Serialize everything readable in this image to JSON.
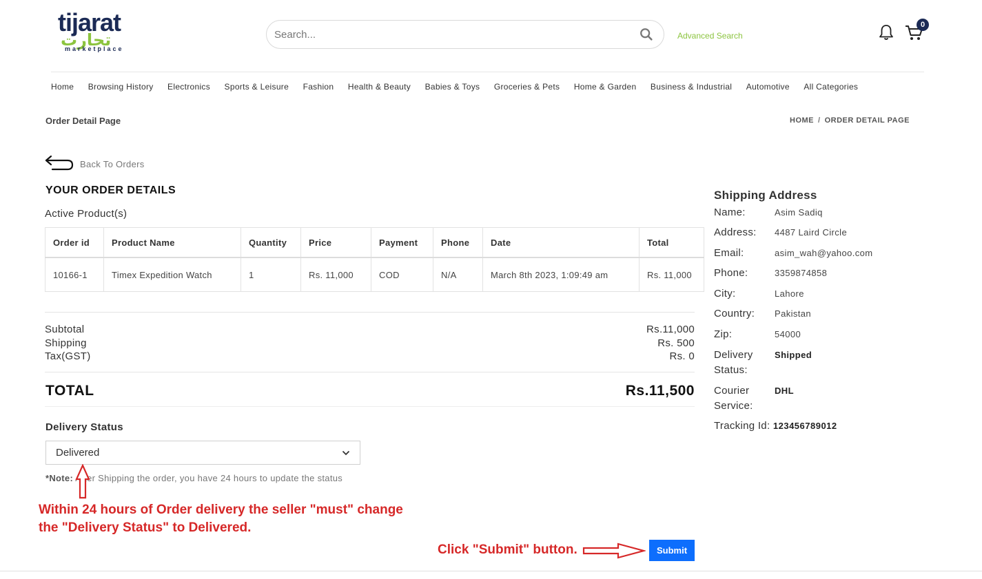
{
  "header": {
    "logo": {
      "main": "tijarat",
      "arabic": "تجارت",
      "sub": "marketplace"
    },
    "search": {
      "placeholder": "Search..."
    },
    "advanced_search": "Advanced Search",
    "cart_count": "0"
  },
  "nav": {
    "items": [
      "Home",
      "Browsing History",
      "Electronics",
      "Sports & Leisure",
      "Fashion",
      "Health & Beauty",
      "Babies & Toys",
      "Groceries & Pets",
      "Home & Garden",
      "Business & Industrial",
      "Automotive",
      "All Categories"
    ]
  },
  "page": {
    "title": "Order Detail Page",
    "breadcrumb": {
      "home": "HOME",
      "sep": "/",
      "current": "ORDER DETAIL PAGE"
    },
    "back": "Back To Orders",
    "order_title": "YOUR ORDER DETAILS",
    "active_products": "Active Product(s)"
  },
  "table": {
    "headers": [
      "Order id",
      "Product Name",
      "Quantity",
      "Price",
      "Payment",
      "Phone",
      "Date",
      "Total"
    ],
    "rows": [
      [
        "10166-1",
        "Timex Expedition Watch",
        "1",
        "Rs. 11,000",
        "COD",
        "N/A",
        "March 8th 2023, 1:09:49 am",
        "Rs. 11,000"
      ]
    ]
  },
  "summary": {
    "subtotal_label": "Subtotal",
    "subtotal_value": "Rs.11,000",
    "shipping_label": "Shipping",
    "shipping_value": "Rs. 500",
    "tax_label": "Tax(GST)",
    "tax_value": "Rs. 0",
    "total_label": "TOTAL",
    "total_value": "Rs.11,500"
  },
  "delivery": {
    "label": "Delivery Status",
    "selected": "Delivered",
    "note_bold": "*Note:",
    "note_text": " After Shipping the order, you have 24 hours to update the status",
    "submit": "Submit"
  },
  "annotations": {
    "text1_line1": "Within 24 hours of Order delivery the seller \"must\" change",
    "text1_line2": "the \"Delivery Status\" to Delivered.",
    "text2": "Click \"Submit\" button.",
    "color": "#d62828"
  },
  "shipping": {
    "title": "Shipping Address",
    "name_label": "Name:",
    "name": "Asim Sadiq",
    "address_label": "Address:",
    "address": "4487 Laird Circle",
    "email_label": "Email:",
    "email": "asim_wah@yahoo.com",
    "phone_label": "Phone:",
    "phone": "3359874858",
    "city_label": "City:",
    "city": "Lahore",
    "country_label": "Country:",
    "country": "Pakistan",
    "zip_label": "Zip:",
    "zip": "54000",
    "delivery_status_label": "Delivery Status:",
    "delivery_status": "Shipped",
    "courier_label": "Courier Service:",
    "courier": "DHL",
    "tracking_label": "Tracking Id:",
    "tracking": "123456789012"
  },
  "colors": {
    "brand_navy": "#1b2a55",
    "brand_green": "#8cc43f",
    "primary": "#0d6efd"
  }
}
